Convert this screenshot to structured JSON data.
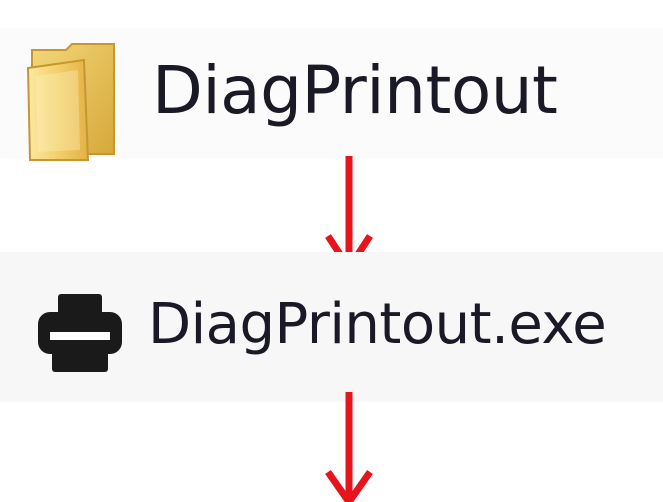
{
  "items": [
    {
      "type": "folder",
      "label": "DiagPrintout",
      "icon": "folder-icon"
    },
    {
      "type": "executable",
      "label": "DiagPrintout.exe",
      "icon": "printer-icon"
    }
  ],
  "arrows": [
    {
      "icon": "down-arrow-icon",
      "color": "#e8141c"
    },
    {
      "icon": "down-arrow-icon",
      "color": "#e8141c"
    }
  ]
}
